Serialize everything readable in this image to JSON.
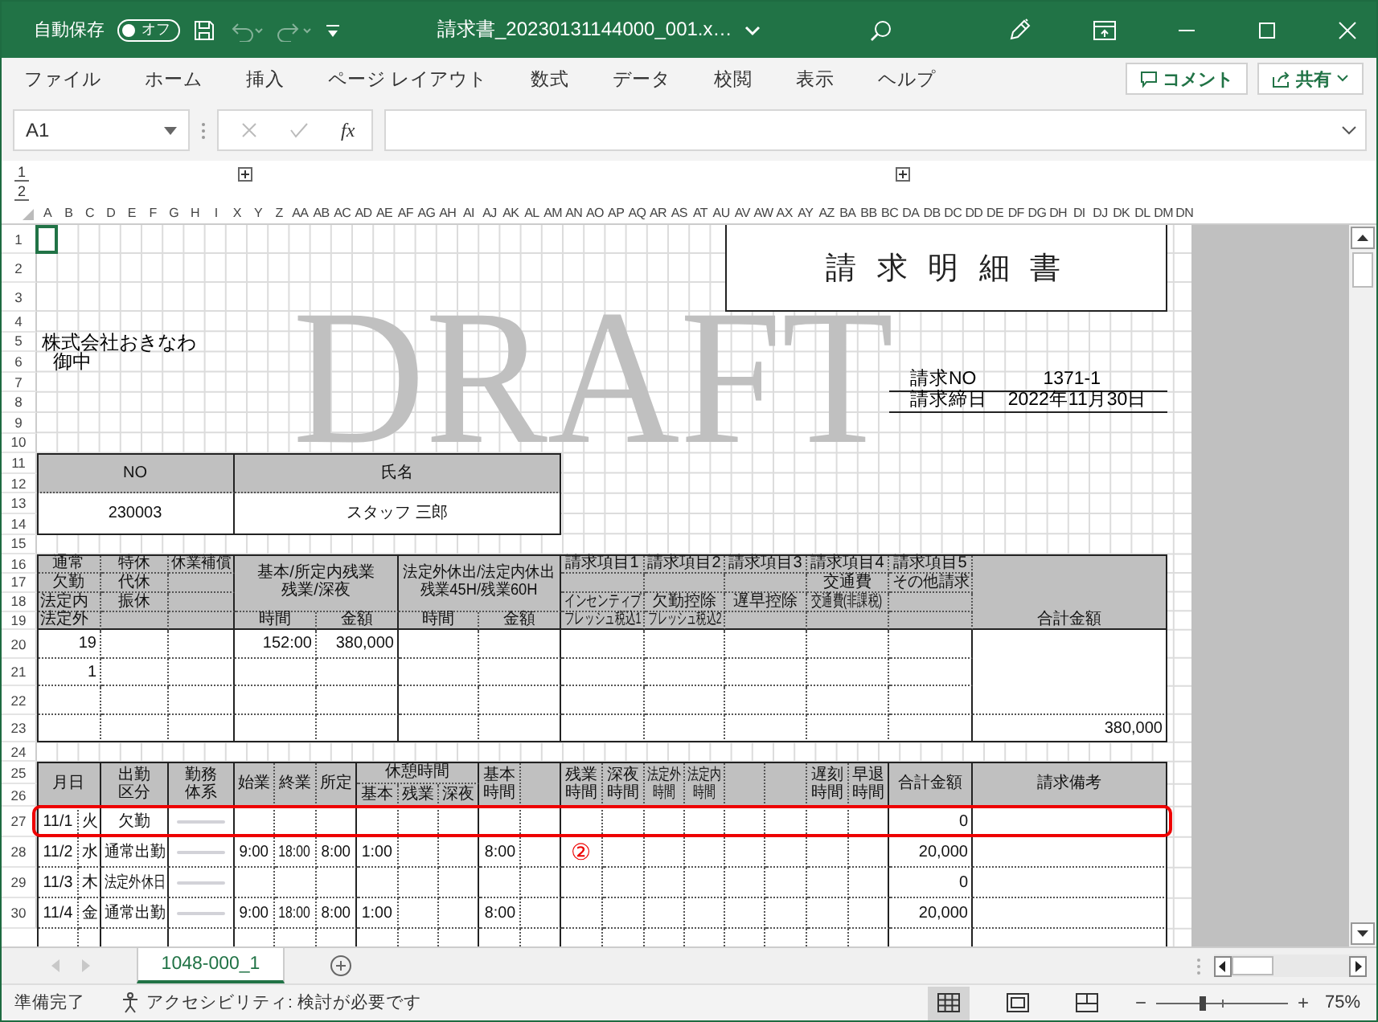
{
  "title_bar": {
    "autosave_label": "自動保存",
    "autosave": {
      "on": false,
      "label": "オフ"
    },
    "filename": "請求書_20230131144000_001.x…"
  },
  "ribbon_tabs": [
    "ファイル",
    "ホーム",
    "挿入",
    "ページ レイアウト",
    "数式",
    "データ",
    "校閲",
    "表示",
    "ヘルプ"
  ],
  "comment_button": "コメント",
  "share_button": "共有",
  "name_box": "A1",
  "function_label": "fx",
  "outline_levels": [
    "1",
    "2"
  ],
  "column_headers": [
    "A",
    "B",
    "C",
    "D",
    "E",
    "F",
    "G",
    "H",
    "I",
    "X",
    "Y",
    "Z",
    "AA",
    "AB",
    "AC",
    "AD",
    "AE",
    "AF",
    "AG",
    "AH",
    "AI",
    "AJ",
    "AK",
    "AL",
    "AM",
    "AN",
    "AO",
    "AP",
    "AQ",
    "AR",
    "AS",
    "AT",
    "AU",
    "AV",
    "AW",
    "AX",
    "AY",
    "AZ",
    "BA",
    "BB",
    "BC",
    "DA",
    "DB",
    "DC",
    "DD",
    "DE",
    "DF",
    "DG",
    "DH",
    "DI",
    "DJ",
    "DK",
    "DL",
    "DM",
    "DN"
  ],
  "row_headers": [
    "1",
    "2",
    "3",
    "4",
    "5",
    "6",
    "7",
    "8",
    "9",
    "10",
    "11",
    "12",
    "13",
    "14",
    "15",
    "16",
    "17",
    "18",
    "19",
    "20",
    "21",
    "22",
    "23",
    "24",
    "25",
    "26",
    "27",
    "28",
    "29",
    "30"
  ],
  "document": {
    "title": "請 求 明 細 書",
    "watermark": "DRAFT",
    "recipient": "株式会社おきなわ",
    "honorific": "御中",
    "invoice_no_label": "請求NO",
    "invoice_no": "1371-1",
    "closing_date_label": "請求締日",
    "closing_date": "2022年11月30日"
  },
  "staff_table": {
    "headers": [
      "NO",
      "氏名"
    ],
    "values": [
      "230003",
      "スタッフ 三郎"
    ]
  },
  "summary": {
    "day_types": [
      [
        "通常",
        "欠勤",
        "法定内",
        "法定外"
      ],
      [
        "特休",
        "代休",
        "振休"
      ],
      [
        "休業補償"
      ]
    ],
    "groups": [
      {
        "title": "基本/所定内残業",
        "subtitle": "残業/深夜",
        "columns": [
          "時間",
          "金額"
        ]
      },
      {
        "title": "法定外休出/法定内休出",
        "subtitle": "残業45H/残業60H",
        "columns": [
          "時間",
          "金額"
        ]
      }
    ],
    "billing_items": [
      {
        "name": "請求項目1",
        "line3": "インセンティブ",
        "line4": "フレッシュ税込1"
      },
      {
        "name": "請求項目2",
        "line3": "欠勤控除",
        "line4": "フレッシュ税込2"
      },
      {
        "name": "請求項目3",
        "line3": "遅早控除"
      },
      {
        "name": "請求項目4",
        "line2": "交通費",
        "line3": "交通費(非課税)"
      },
      {
        "name": "請求項目5",
        "line2": "その他請求"
      }
    ],
    "total_label": "合計金額",
    "regular_days": [
      "19",
      "1"
    ],
    "basic_hours": "152:00",
    "basic_amount": "380,000",
    "total": "380,000"
  },
  "daily": {
    "headers": [
      "月日",
      "出勤区分",
      "勤務体系",
      "始業",
      "終業",
      "所定",
      "休憩時間",
      "基本時間",
      "残業時間",
      "深夜時間",
      "法定外時間",
      "法定内時間",
      "遅刻時間",
      "早退時間",
      "合計金額",
      "請求備考",
      "基本",
      "残業",
      "深夜"
    ],
    "rows": [
      {
        "date": "11/1",
        "weekday": "火",
        "attendance": "欠勤",
        "total": "0",
        "highlighted": true
      },
      {
        "date": "11/2",
        "weekday": "水",
        "attendance": "通常出勤",
        "start": "9:00",
        "end": "18:00",
        "scheduled": "8:00",
        "break_basic": "1:00",
        "basic_hours": "8:00",
        "overtime_mark": "②",
        "total": "20,000",
        "highlighted": false
      },
      {
        "date": "11/3",
        "weekday": "木",
        "attendance": "法定外休日",
        "total": "0",
        "highlighted": false
      },
      {
        "date": "11/4",
        "weekday": "金",
        "attendance": "通常出勤",
        "start": "9:00",
        "end": "18:00",
        "scheduled": "8:00",
        "break_basic": "1:00",
        "basic_hours": "8:00",
        "total": "20,000",
        "highlighted": false
      }
    ]
  },
  "sheet_tabs": [
    {
      "label": "1048-000_1",
      "selected": true
    }
  ],
  "status_bar": {
    "ready": "準備完了",
    "accessibility": "アクセシビリティ: 検討が必要です",
    "views": [
      {
        "kind": "normal",
        "selected": true
      },
      {
        "kind": "page_layout",
        "selected": false
      },
      {
        "kind": "page_break",
        "selected": false
      }
    ],
    "zoom_out": "−",
    "zoom_in": "+",
    "zoom": {
      "level": 0.36,
      "percent": "75%"
    }
  }
}
